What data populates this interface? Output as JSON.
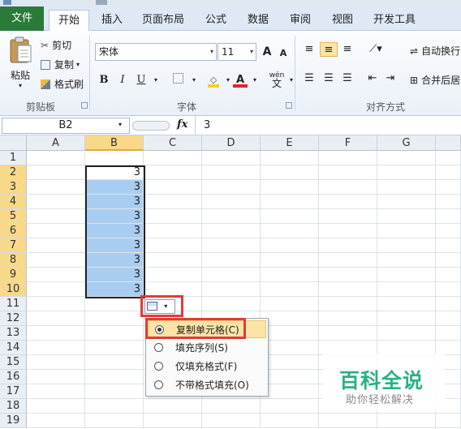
{
  "ribbon_tabs": [
    "文件",
    "开始",
    "插入",
    "页面布局",
    "公式",
    "数据",
    "审阅",
    "视图",
    "开发工具"
  ],
  "clipboard": {
    "paste_label": "粘贴",
    "cut_label": "剪切",
    "copy_label": "复制",
    "format_painter_label": "格式刷",
    "group_label": "剪贴板"
  },
  "font": {
    "font_name": "宋体",
    "font_size": "11",
    "bold": "B",
    "italic": "I",
    "underline": "U",
    "grow_label": "A",
    "shrink_label": "A",
    "font_color_label": "A",
    "phonetic_label": "wén",
    "group_label": "字体"
  },
  "alignment": {
    "wrap_label": "自动换行",
    "merge_label": "合并后居",
    "group_label": "对齐方式"
  },
  "formula_bar": {
    "name_box": "B2",
    "fx_label": "fx",
    "formula_value": "3"
  },
  "grid": {
    "columns": [
      "A",
      "B",
      "C",
      "D",
      "E",
      "F",
      "G"
    ],
    "rows": [
      "1",
      "2",
      "3",
      "4",
      "5",
      "6",
      "7",
      "8",
      "9",
      "10",
      "11",
      "12",
      "13",
      "14",
      "15",
      "16",
      "17",
      "18",
      "19"
    ],
    "column_b_values": [
      "3",
      "3",
      "3",
      "3",
      "3",
      "3",
      "3",
      "3",
      "3"
    ],
    "selected_column": "B"
  },
  "autofill_menu": {
    "items": [
      "复制单元格(C)",
      "填充序列(S)",
      "仅填充格式(F)",
      "不带格式填充(O)"
    ],
    "selected_index": 0
  },
  "watermark": {
    "title": "百科全说",
    "subtitle": "助你轻松解决"
  },
  "colors": {
    "file_tab": "#2a7a3a",
    "selection_fill": "#a9cdf0",
    "highlight_outline": "#e23b3b",
    "watermark_green": "#29b089"
  }
}
